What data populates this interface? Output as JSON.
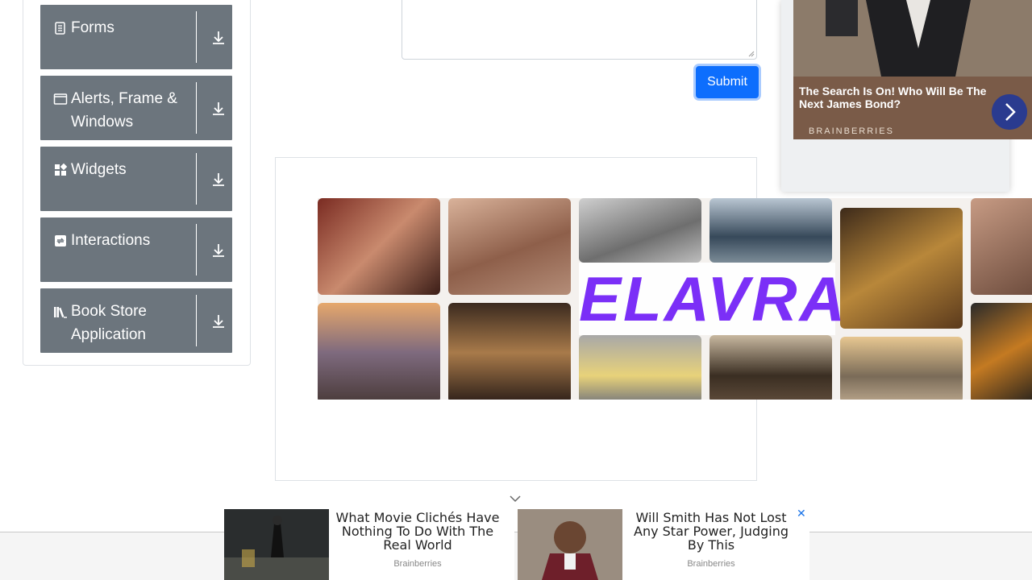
{
  "sidebar": {
    "groups": [
      {
        "label": "Forms",
        "icon": "document-icon"
      },
      {
        "label": "Alerts, Frame & Windows",
        "icon": "window-icon"
      },
      {
        "label": "Widgets",
        "icon": "widgets-icon"
      },
      {
        "label": "Interactions",
        "icon": "interactions-icon"
      },
      {
        "label": "Book Store Application",
        "icon": "books-icon"
      }
    ]
  },
  "form": {
    "submit_label": "Submit"
  },
  "ad_frame": {
    "brand": "ELAVRA"
  },
  "ad_right": {
    "caption": "The Search Is On! Who Will Be The Next James Bond?",
    "brand": "BRAINBERRIES"
  },
  "bottom_ads": [
    {
      "title": "What Movie Clichés Have Nothing To Do With The Real World",
      "source": "Brainberries"
    },
    {
      "title": "Will Smith Has Not Lost Any Star Power, Judging By This",
      "source": "Brainberries"
    }
  ],
  "colors": {
    "accent": "#0d6efd",
    "sidebar_group": "#6c757d",
    "elavra": "#7b2ff7"
  }
}
